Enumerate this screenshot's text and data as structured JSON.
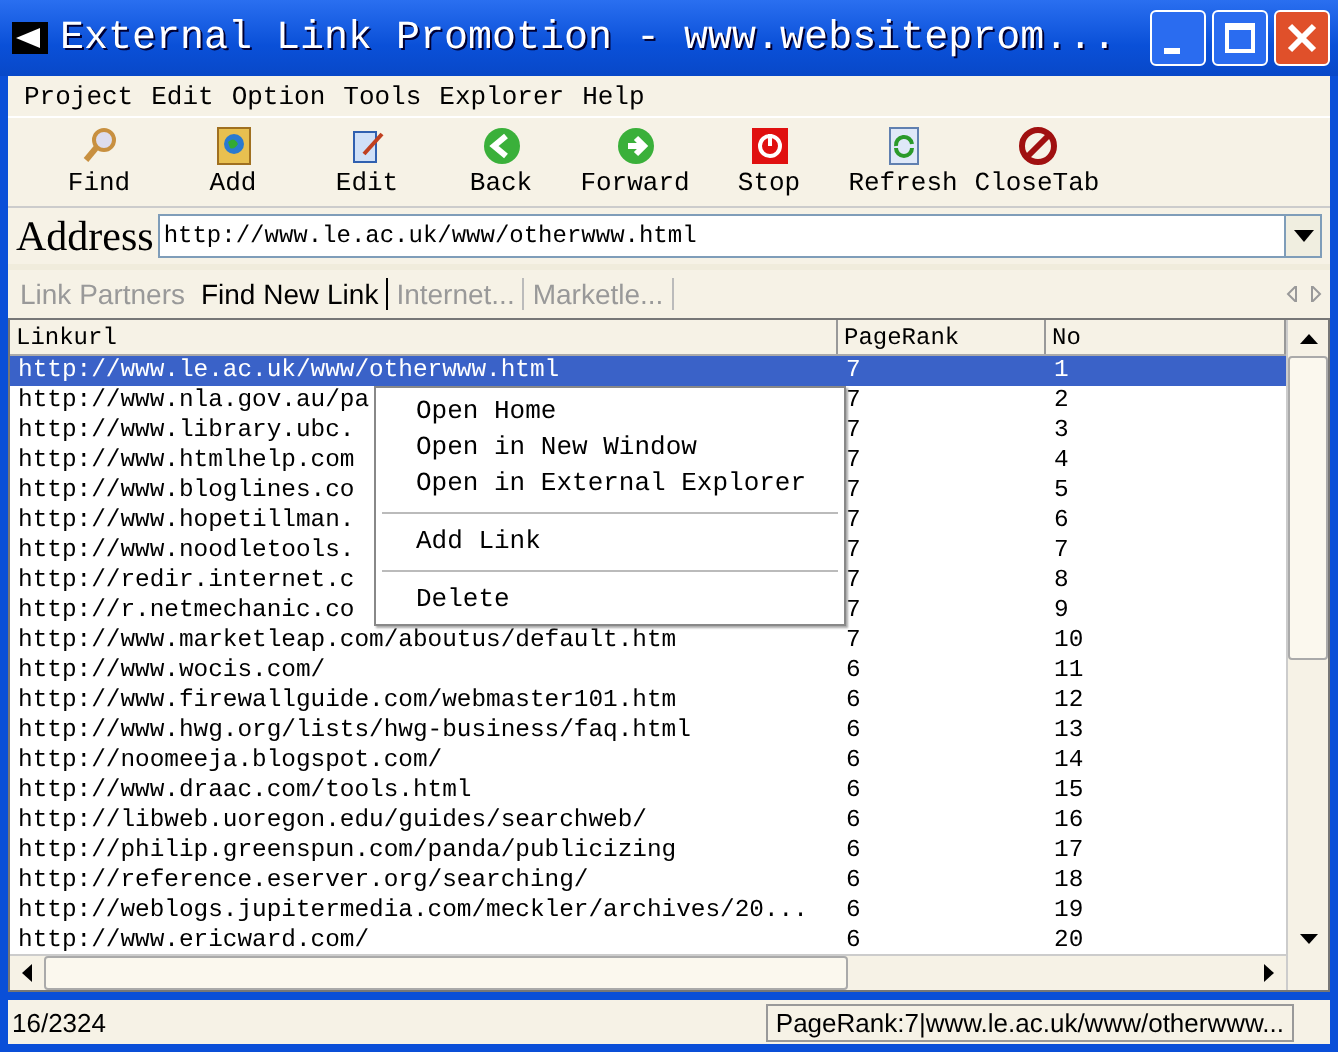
{
  "window": {
    "title": "External Link Promotion - www.websiteprom..."
  },
  "menu": [
    "Project",
    "Edit",
    "Option",
    "Tools",
    "Explorer",
    "Help"
  ],
  "toolbar": [
    {
      "label": "Find",
      "kind": "find"
    },
    {
      "label": "Add",
      "kind": "add"
    },
    {
      "label": "Edit",
      "kind": "edit"
    },
    {
      "label": "Back",
      "kind": "back"
    },
    {
      "label": "Forward",
      "kind": "forward"
    },
    {
      "label": "Stop",
      "kind": "stop"
    },
    {
      "label": "Refresh",
      "kind": "refresh"
    },
    {
      "label": "CloseTab",
      "kind": "close"
    }
  ],
  "address": {
    "label": "Address",
    "value": "http://www.le.ac.uk/www/otherwww.html"
  },
  "tabs": [
    {
      "label": "Link Partners",
      "selected": false
    },
    {
      "label": "Find New Link",
      "selected": true
    },
    {
      "label": "Internet...",
      "selected": false
    },
    {
      "label": "Marketle...",
      "selected": false
    }
  ],
  "table": {
    "columns": [
      "Linkurl",
      "PageRank",
      "No"
    ],
    "rows": [
      {
        "cells": [
          "http://www.le.ac.uk/www/otherwww.html",
          "7",
          "1"
        ],
        "selected": true
      },
      {
        "cells": [
          "http://www.nla.gov.au/pa",
          "7",
          "2"
        ],
        "selected": false
      },
      {
        "cells": [
          "http://www.library.ubc.",
          "7",
          "3"
        ],
        "selected": false
      },
      {
        "cells": [
          "http://www.htmlhelp.com",
          "7",
          "4"
        ],
        "selected": false
      },
      {
        "cells": [
          "http://www.bloglines.co",
          "7",
          "5"
        ],
        "selected": false
      },
      {
        "cells": [
          "http://www.hopetillman.",
          "7",
          "6"
        ],
        "selected": false
      },
      {
        "cells": [
          "http://www.noodletools.",
          "7",
          "7"
        ],
        "selected": false
      },
      {
        "cells": [
          "http://redir.internet.c",
          "7",
          "8"
        ],
        "selected": false
      },
      {
        "cells": [
          "http://r.netmechanic.co",
          "7",
          "9"
        ],
        "selected": false
      },
      {
        "cells": [
          "http://www.marketleap.com/aboutus/default.htm",
          "7",
          "10"
        ],
        "selected": false
      },
      {
        "cells": [
          "http://www.wocis.com/",
          "6",
          "11"
        ],
        "selected": false
      },
      {
        "cells": [
          "http://www.firewallguide.com/webmaster101.htm",
          "6",
          "12"
        ],
        "selected": false
      },
      {
        "cells": [
          "http://www.hwg.org/lists/hwg-business/faq.html",
          "6",
          "13"
        ],
        "selected": false
      },
      {
        "cells": [
          "http://noomeeja.blogspot.com/",
          "6",
          "14"
        ],
        "selected": false
      },
      {
        "cells": [
          "http://www.draac.com/tools.html",
          "6",
          "15"
        ],
        "selected": false
      },
      {
        "cells": [
          "http://libweb.uoregon.edu/guides/searchweb/",
          "6",
          "16"
        ],
        "selected": false
      },
      {
        "cells": [
          "http://philip.greenspun.com/panda/publicizing",
          "6",
          "17"
        ],
        "selected": false
      },
      {
        "cells": [
          "http://reference.eserver.org/searching/",
          "6",
          "18"
        ],
        "selected": false
      },
      {
        "cells": [
          "http://weblogs.jupitermedia.com/meckler/archives/20...",
          "6",
          "19"
        ],
        "selected": false
      },
      {
        "cells": [
          "http://www.ericward.com/",
          "6",
          "20"
        ],
        "selected": false
      }
    ]
  },
  "context_menu": [
    {
      "kind": "item",
      "label": "Open Home"
    },
    {
      "kind": "item",
      "label": "Open in New Window"
    },
    {
      "kind": "item",
      "label": "Open in External Explorer"
    },
    {
      "kind": "separator"
    },
    {
      "kind": "item",
      "label": "Add Link"
    },
    {
      "kind": "separator"
    },
    {
      "kind": "item",
      "label": "Delete"
    }
  ],
  "status_bar": {
    "count": "16/2324",
    "detail": "PageRank:7|www.le.ac.uk/www/otherwww..."
  }
}
